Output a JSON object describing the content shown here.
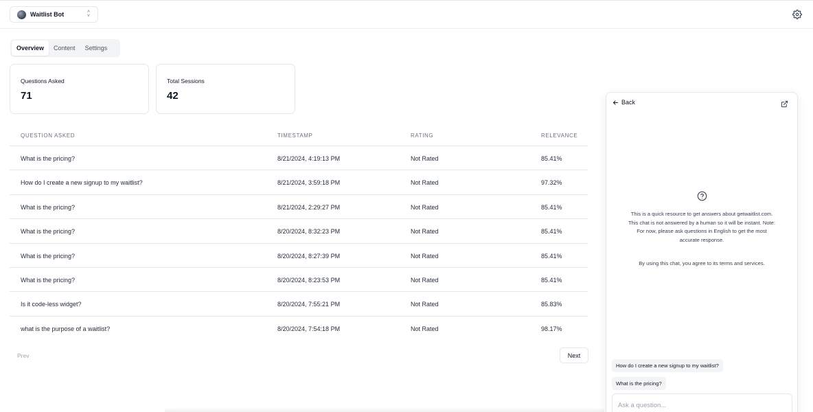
{
  "bot_selector": {
    "name": "Waitlist Bot"
  },
  "tabs": [
    {
      "label": "Overview",
      "active": true
    },
    {
      "label": "Content",
      "active": false
    },
    {
      "label": "Settings",
      "active": false
    }
  ],
  "stats": [
    {
      "label": "Questions Asked",
      "value": "71"
    },
    {
      "label": "Total Sessions",
      "value": "42"
    }
  ],
  "table": {
    "headers": [
      "QUESTION ASKED",
      "TIMESTAMP",
      "RATING",
      "RELEVANCE"
    ],
    "rows": [
      {
        "question": "What is the pricing?",
        "timestamp": "8/21/2024, 4:19:13 PM",
        "rating": "Not Rated",
        "relevance": "85.41%"
      },
      {
        "question": "How do I create a new signup to my waitlist?",
        "timestamp": "8/21/2024, 3:59:18 PM",
        "rating": "Not Rated",
        "relevance": "97.32%"
      },
      {
        "question": "What is the pricing?",
        "timestamp": "8/21/2024, 2:29:27 PM",
        "rating": "Not Rated",
        "relevance": "85.41%"
      },
      {
        "question": "What is the pricing?",
        "timestamp": "8/20/2024, 8:32:23 PM",
        "rating": "Not Rated",
        "relevance": "85.41%"
      },
      {
        "question": "What is the pricing?",
        "timestamp": "8/20/2024, 8:27:39 PM",
        "rating": "Not Rated",
        "relevance": "85.41%"
      },
      {
        "question": "What is the pricing?",
        "timestamp": "8/20/2024, 8:23:53 PM",
        "rating": "Not Rated",
        "relevance": "85.41%"
      },
      {
        "question": "Is it code-less widget?",
        "timestamp": "8/20/2024, 7:55:21 PM",
        "rating": "Not Rated",
        "relevance": "85.83%"
      },
      {
        "question": "what is the purpose of a waitlist?",
        "timestamp": "8/20/2024, 7:54:18 PM",
        "rating": "Not Rated",
        "relevance": "98.17%"
      }
    ]
  },
  "pagination": {
    "prev_label": "Prev",
    "next_label": "Next"
  },
  "chat": {
    "back_label": "Back",
    "intro_text": "This is a quick resource to get answers about getwaitlist.com. This chat is not answered by a human so it will be instant. Note: For now, please ask questions in English to get the most accurate response.",
    "terms_text": "By using this chat, you agree to its terms and services.",
    "suggestions": [
      "How do I create a new signup to my waitlist?",
      "What is the pricing?"
    ],
    "input_placeholder": "Ask a question..."
  },
  "icons": {
    "settings": "gear-icon",
    "bot_select": "chevron-up-down-icon",
    "back": "arrow-left-icon",
    "open_external": "external-link-icon",
    "help": "question-circle-icon"
  },
  "colors": {
    "border": "#e5e7eb",
    "muted_text": "#6b7280",
    "tab_bg": "#f3f4f6",
    "text": "#111827"
  }
}
